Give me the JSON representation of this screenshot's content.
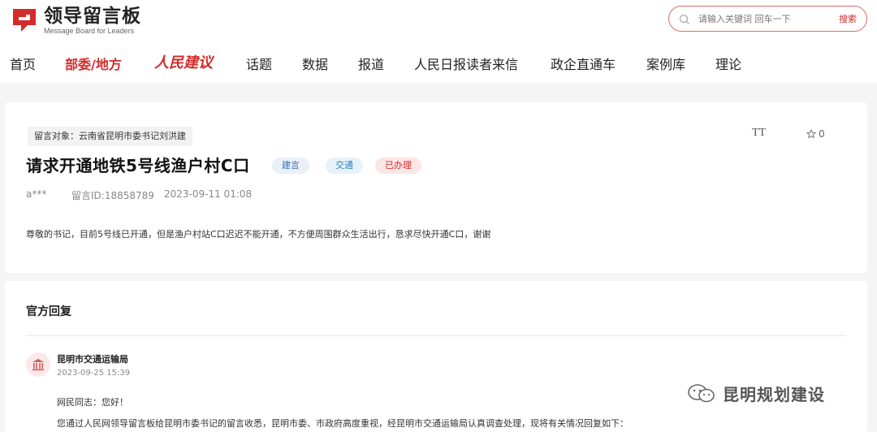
{
  "site": {
    "logo_title": "领导留言板",
    "logo_subtitle": "Message Board for Leaders"
  },
  "search": {
    "placeholder": "请输入关键词 回车一下",
    "button": "搜索"
  },
  "nav": {
    "items": [
      "首页",
      "部委/地方",
      "人民建议",
      "话题",
      "数据",
      "报道",
      "人民日报读者来信",
      "政企直通车",
      "案例库",
      "理论"
    ],
    "active_index": 1
  },
  "message": {
    "target": "留言对象：云南省昆明市委书记刘洪建",
    "font_toggle": "TT",
    "star_count": "0",
    "title": "请求开通地铁5号线渔户村C口",
    "tags": [
      "建言",
      "交通",
      "已办理"
    ],
    "author": "a***",
    "message_id": "留言ID:18858789",
    "datetime": "2023-09-11 01:08",
    "body": "尊敬的书记，目前5号线已开通，但是渔户村站C口迟迟不能开通，不方便周围群众生活出行，恳求尽快开通C口，谢谢"
  },
  "reply": {
    "heading": "官方回复",
    "org": "昆明市交通运输局",
    "datetime": "2023-09-25 15:39",
    "greeting": "网民同志：您好！",
    "para1": "您通过人民网领导留言板给昆明市委书记的留言收悉，昆明市委、市政府高度重视，经昆明市交通运输局认真调查处理，现将有关情况回复如下："
  },
  "watermark": "昆明规划建设",
  "colors": {
    "brand_red": "#d42b2b"
  }
}
